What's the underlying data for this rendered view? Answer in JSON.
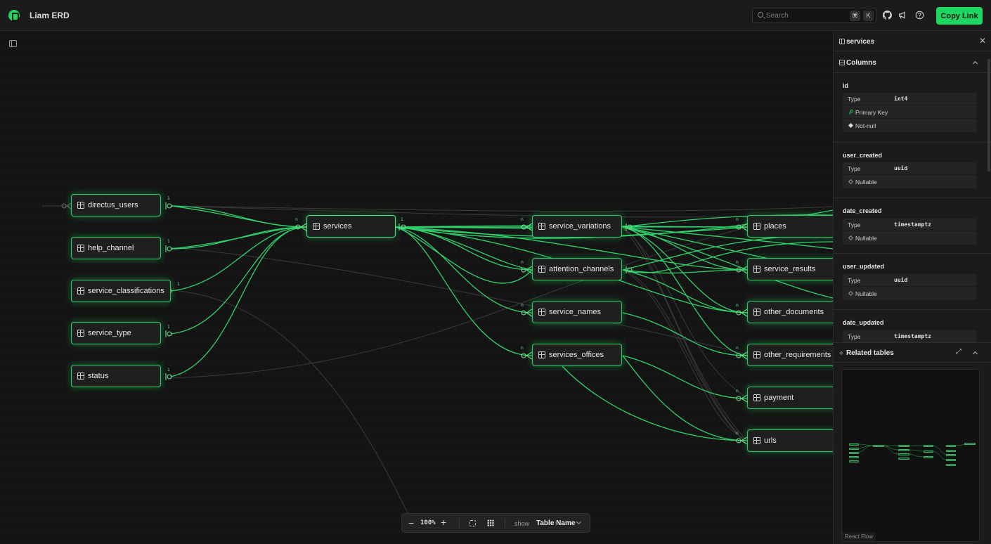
{
  "header": {
    "title": "Liam ERD",
    "search_placeholder": "Search",
    "shortcut_cmd": "⌘",
    "shortcut_key": "K",
    "copy_link": "Copy Link"
  },
  "canvas": {
    "nodes": [
      {
        "name": "directus_users"
      },
      {
        "name": "help_channel"
      },
      {
        "name": "service_classifications"
      },
      {
        "name": "service_type"
      },
      {
        "name": "status"
      },
      {
        "name": "services"
      },
      {
        "name": "service_variations"
      },
      {
        "name": "attention_channels"
      },
      {
        "name": "service_names"
      },
      {
        "name": "services_offices"
      },
      {
        "name": "places"
      },
      {
        "name": "service_results"
      },
      {
        "name": "other_documents"
      },
      {
        "name": "other_requirements"
      },
      {
        "name": "payment"
      },
      {
        "name": "urls"
      }
    ],
    "cardinality_one": "1",
    "cardinality_many": "n"
  },
  "toolbar": {
    "zoom_out": "−",
    "zoom_level": "100%",
    "zoom_in": "+",
    "show_label": "show",
    "show_value": "Table Name"
  },
  "panel": {
    "table_name": "services",
    "close": "✕",
    "columns_title": "Columns",
    "columns": [
      {
        "name": "id",
        "type_label": "Type",
        "type": "int4",
        "flags": [
          "Primary Key",
          "Not-null"
        ]
      },
      {
        "name": "user_created",
        "type_label": "Type",
        "type": "uuid",
        "flags": [
          "Nullable"
        ]
      },
      {
        "name": "date_created",
        "type_label": "Type",
        "type": "timestamptz",
        "flags": [
          "Nullable"
        ]
      },
      {
        "name": "user_updated",
        "type_label": "Type",
        "type": "uuid",
        "flags": [
          "Nullable"
        ]
      },
      {
        "name": "date_updated",
        "type_label": "Type",
        "type": "timestamptz",
        "flags": []
      }
    ],
    "related_title": "Related tables",
    "minimap_badge": "React Flow"
  },
  "colors": {
    "accent": "#1ed761",
    "edge": "#2fd16b",
    "background": "#141414"
  }
}
